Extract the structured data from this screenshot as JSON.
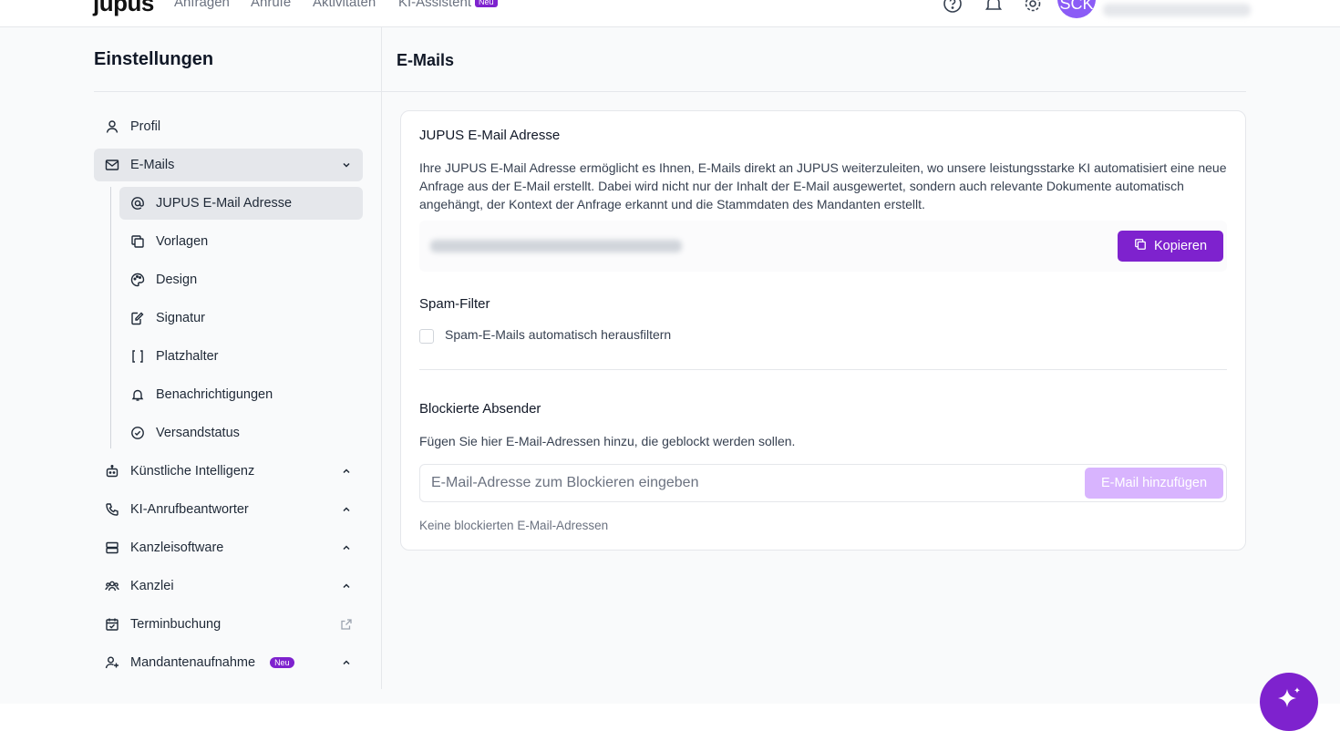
{
  "topnav": {
    "logo": "jupus",
    "items": [
      "Anfragen",
      "Anrufe",
      "Aktivitäten",
      "KI-Assistent"
    ],
    "new_badge": "Neu",
    "avatar_initials": "SCK"
  },
  "sidebar": {
    "title": "Einstellungen",
    "items": [
      {
        "label": "Profil",
        "icon": "user-icon"
      },
      {
        "label": "E-Mails",
        "icon": "mail-icon",
        "expanded": true
      },
      {
        "label": "Künstliche Intelligenz",
        "icon": "robot-icon"
      },
      {
        "label": "KI-Anrufbeantworter",
        "icon": "phone-icon"
      },
      {
        "label": "Kanzleisoftware",
        "icon": "server-icon"
      },
      {
        "label": "Kanzlei",
        "icon": "team-icon"
      },
      {
        "label": "Terminbuchung",
        "icon": "calendar-check-icon"
      },
      {
        "label": "Mandantenaufnahme",
        "icon": "user-plus-icon",
        "badge": "Neu"
      }
    ],
    "email_subitems": [
      {
        "label": "JUPUS E-Mail Adresse",
        "icon": "at-icon",
        "active": true
      },
      {
        "label": "Vorlagen",
        "icon": "copy-icon"
      },
      {
        "label": "Design",
        "icon": "palette-icon"
      },
      {
        "label": "Signatur",
        "icon": "signature-icon"
      },
      {
        "label": "Platzhalter",
        "icon": "brackets-icon"
      },
      {
        "label": "Benachrichtigungen",
        "icon": "bell-icon"
      },
      {
        "label": "Versandstatus",
        "icon": "check-circle-icon"
      }
    ]
  },
  "main": {
    "title": "E-Mails",
    "jupus_email": {
      "heading": "JUPUS E-Mail Adresse",
      "description": "Ihre JUPUS E-Mail Adresse ermöglicht es Ihnen, E-Mails direkt an JUPUS weiterzuleiten, wo unsere leistungsstarke KI automatisiert eine neue Anfrage aus der E-Mail erstellt. Dabei wird nicht nur der Inhalt der E-Mail ausgewertet, sondern auch relevante Dokumente automatisch angehängt, der Kontext der Anfrage erkannt und die Stammdaten des Mandanten erstellt.",
      "copy_button": "Kopieren"
    },
    "spam_filter": {
      "heading": "Spam-Filter",
      "checkbox_label": "Spam-E-Mails automatisch herausfiltern",
      "checked": false
    },
    "blocked_senders": {
      "heading": "Blockierte Absender",
      "description": "Fügen Sie hier E-Mail-Adressen hinzu, die geblockt werden sollen.",
      "input_placeholder": "E-Mail-Adresse zum Blockieren eingeben",
      "add_button": "E-Mail hinzufügen",
      "empty_text": "Keine blockierten E-Mail-Adressen"
    }
  },
  "colors": {
    "accent": "#7e22ce",
    "accent_disabled": "#d8b4fe",
    "avatar": "#8b5cf6"
  }
}
